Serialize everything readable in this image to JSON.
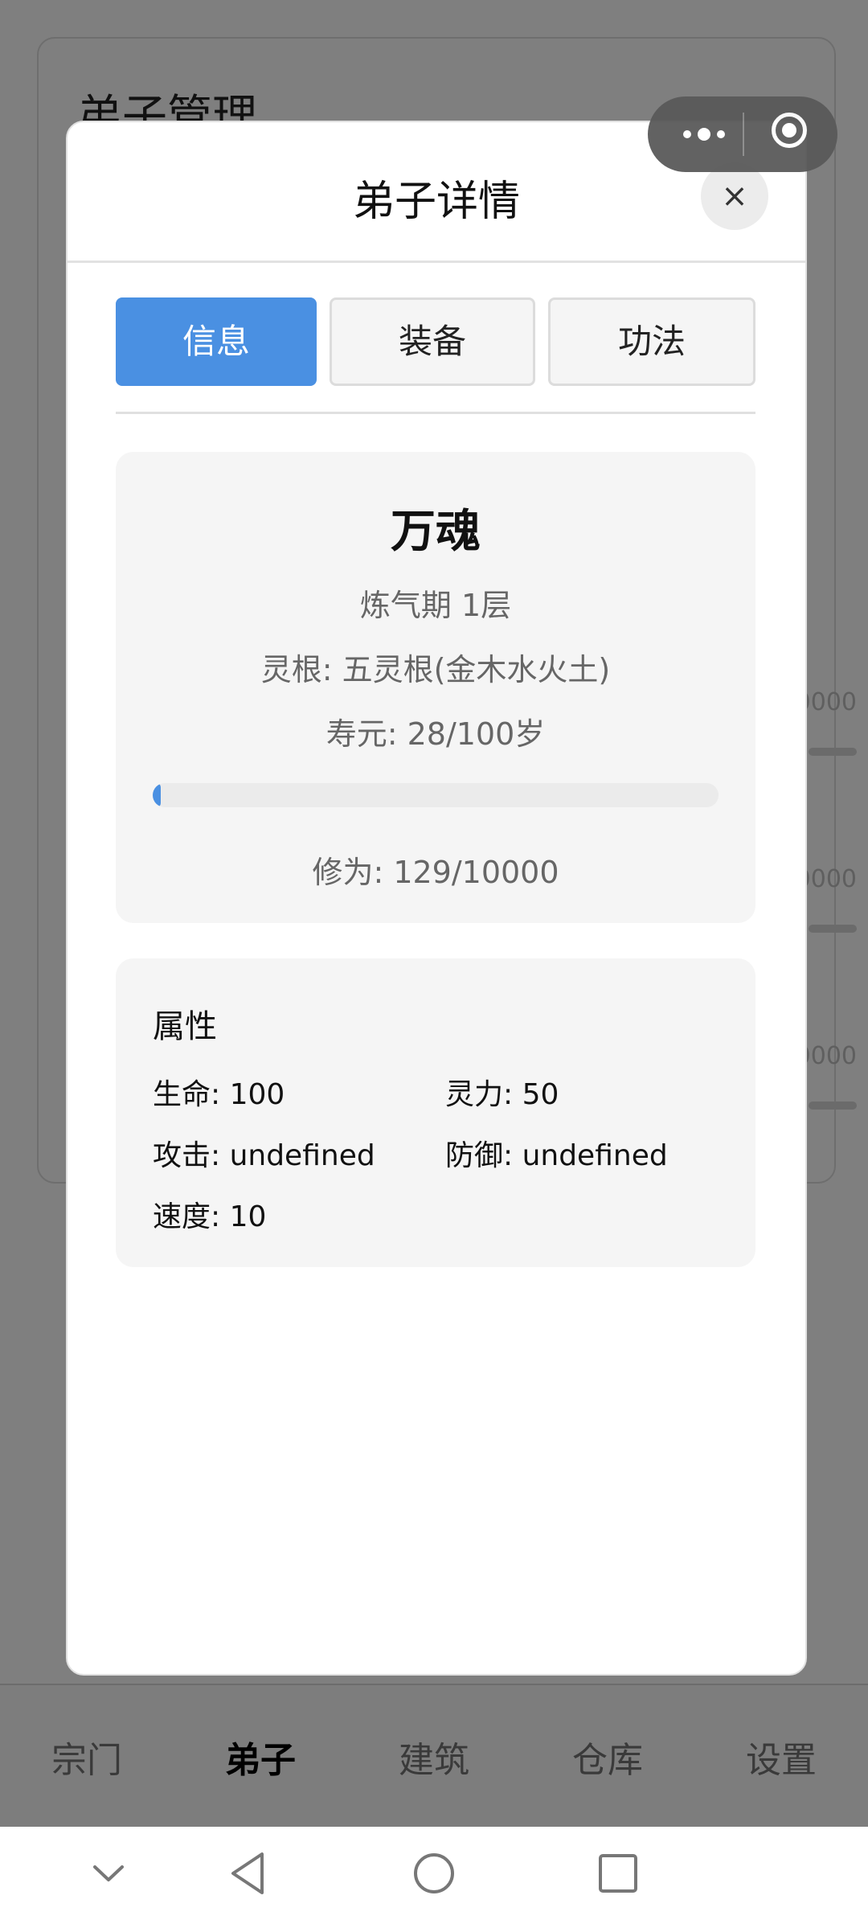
{
  "background": {
    "page_title": "弟子管理",
    "side_values": [
      "0000",
      "0000",
      "0000"
    ]
  },
  "bottom_tabs": [
    {
      "label": "宗门",
      "active": false
    },
    {
      "label": "弟子",
      "active": true
    },
    {
      "label": "建筑",
      "active": false
    },
    {
      "label": "仓库",
      "active": false
    },
    {
      "label": "设置",
      "active": false
    }
  ],
  "modal": {
    "title": "弟子详情",
    "close_icon": "×",
    "tabs": [
      {
        "label": "信息",
        "active": true
      },
      {
        "label": "装备",
        "active": false
      },
      {
        "label": "功法",
        "active": false
      }
    ],
    "info": {
      "name": "万魂",
      "realm": "炼气期 1层",
      "spirit_root": "灵根: 五灵根(金木水火土)",
      "lifespan": "寿元: 28/100岁",
      "cultivation_progress": 0.0129,
      "cultivation": "修为: 129/10000"
    },
    "attributes": {
      "title": "属性",
      "hp": "生命: 100",
      "mana": "灵力: 50",
      "attack": "攻击: undefined",
      "defense": "防御: undefined",
      "speed": "速度: 10"
    }
  },
  "colors": {
    "accent": "#4a90e2",
    "overlay": "#7f7f7f"
  },
  "icons": {
    "capsule_menu": "more-dots-icon",
    "capsule_close": "target-icon",
    "nav": [
      "chevron-down-icon",
      "back-triangle-icon",
      "home-circle-icon",
      "recents-square-icon"
    ]
  }
}
